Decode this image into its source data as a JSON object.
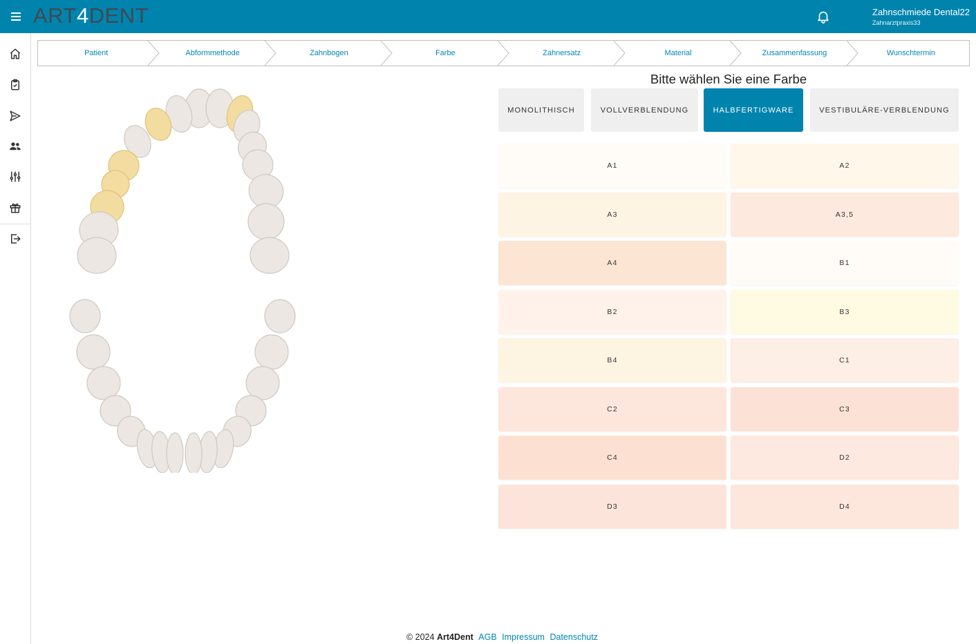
{
  "header": {
    "logo_prefix": "ART",
    "logo_accent": "4",
    "logo_suffix": "DENT",
    "user_name": "Zahnschmiede Dental22",
    "user_practice": "Zahnarztpraxis33",
    "bg_color": "#0084ad"
  },
  "sidebar": {
    "items": [
      {
        "icon": "home-icon"
      },
      {
        "icon": "clipboard-check-icon"
      },
      {
        "icon": "send-icon"
      },
      {
        "icon": "users-icon"
      },
      {
        "icon": "sliders-icon"
      },
      {
        "icon": "gift-icon"
      },
      {
        "icon": "logout-icon"
      }
    ]
  },
  "stepper": {
    "steps": [
      "Patient",
      "Abformmethode",
      "Zahnbogen",
      "Farbe",
      "Zahnersatz",
      "Material",
      "Zusammenfassung",
      "Wunschtermin"
    ]
  },
  "main": {
    "heading": "Bitte wählen Sie eine Farbe",
    "types": [
      "MONOLITHISCH",
      "VOLLVERBLENDUNG",
      "HALBFERTIGWARE",
      "VESTIBULÄRE-VERBLENDUNG"
    ],
    "active_type": "HALBFERTIGWARE",
    "shades": [
      {
        "label": "A1",
        "color": "#fffcf8"
      },
      {
        "label": "A2",
        "color": "#fef7ea"
      },
      {
        "label": "A3",
        "color": "#fdf4e4"
      },
      {
        "label": "A3,5",
        "color": "#fde9dd"
      },
      {
        "label": "A4",
        "color": "#fde5d3"
      },
      {
        "label": "B1",
        "color": "#fffcf8"
      },
      {
        "label": "B2",
        "color": "#fef2ea"
      },
      {
        "label": "B3",
        "color": "#fefbe2"
      },
      {
        "label": "B4",
        "color": "#fdf4e2"
      },
      {
        "label": "C1",
        "color": "#fdeee6"
      },
      {
        "label": "C2",
        "color": "#fde6dc"
      },
      {
        "label": "C3",
        "color": "#fce1d6"
      },
      {
        "label": "C4",
        "color": "#fce1d2"
      },
      {
        "label": "D2",
        "color": "#fde9e0"
      },
      {
        "label": "D3",
        "color": "#fde4da"
      },
      {
        "label": "D4",
        "color": "#fde6dc"
      }
    ]
  },
  "teeth": {
    "selected_color": "#f2dca0",
    "tooth_color": "#ece7e2"
  },
  "footer": {
    "copyright": "© 2024",
    "brand": "Art4Dent",
    "links": [
      "AGB",
      "Impressum",
      "Datenschutz"
    ]
  }
}
